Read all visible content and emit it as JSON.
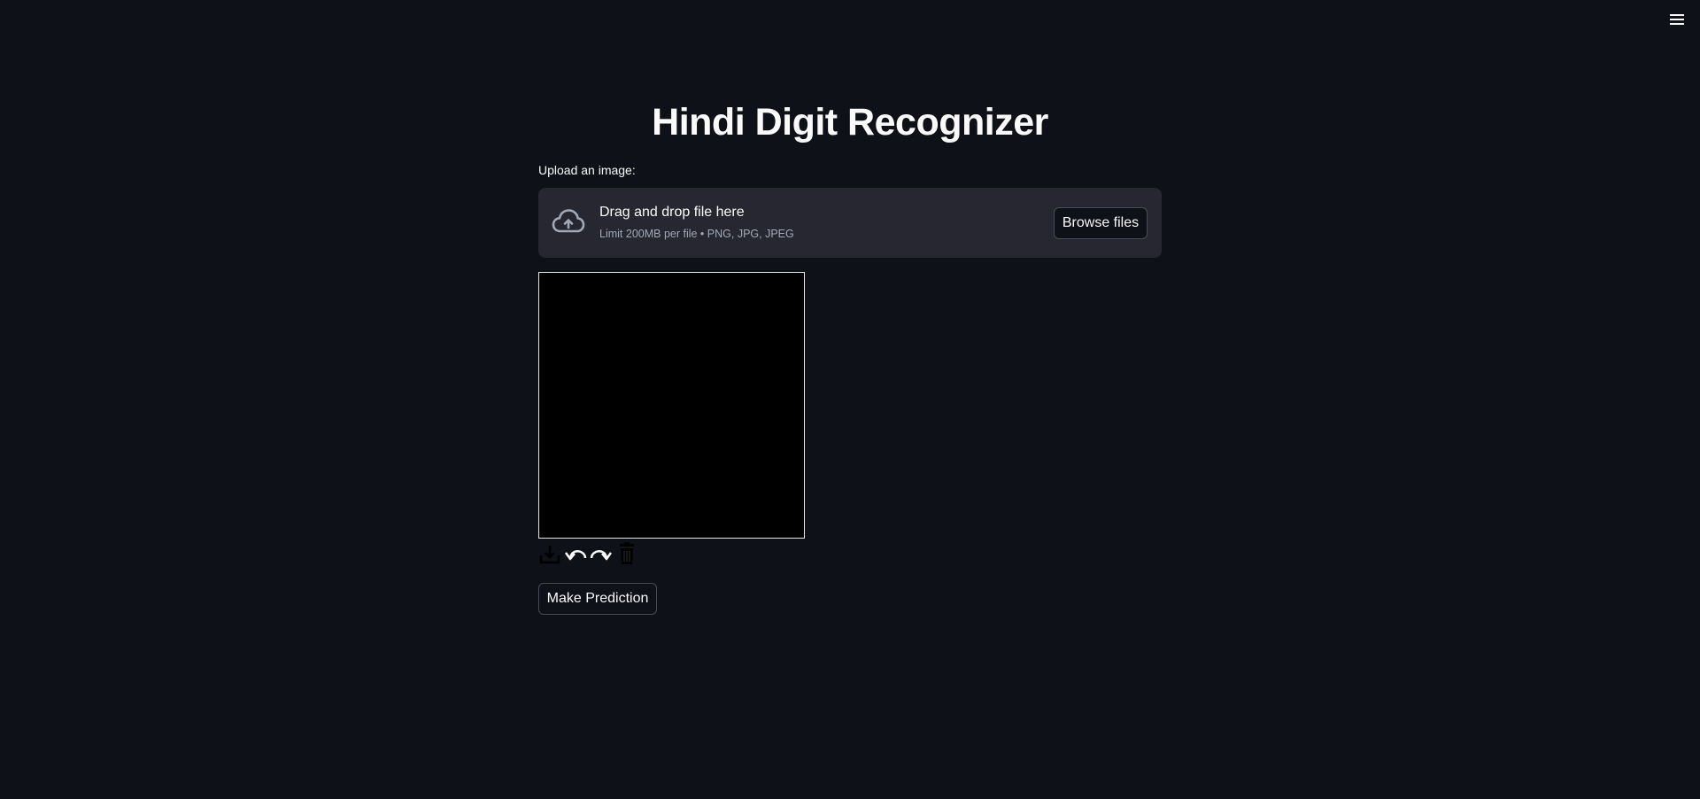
{
  "app": {
    "title": "Hindi Digit Recognizer",
    "menu_icon": "hamburger-menu-icon"
  },
  "uploader": {
    "label": "Upload an image:",
    "drop_text": "Drag and drop file here",
    "limit_text": "Limit 200MB per file • PNG, JPG, JPEG",
    "browse_label": "Browse files",
    "icon": "cloud-upload-icon"
  },
  "canvas": {
    "background": "#000000",
    "border": "#e6e6e6",
    "toolbar": [
      {
        "icon": "download-icon"
      },
      {
        "icon": "undo-icon"
      },
      {
        "icon": "redo-icon"
      },
      {
        "icon": "trash-icon"
      }
    ]
  },
  "actions": {
    "predict_label": "Make Prediction"
  },
  "colors": {
    "background": "#0e1117",
    "panel": "#262730",
    "text": "#fafafa",
    "muted_text": "#a3a8b8"
  }
}
